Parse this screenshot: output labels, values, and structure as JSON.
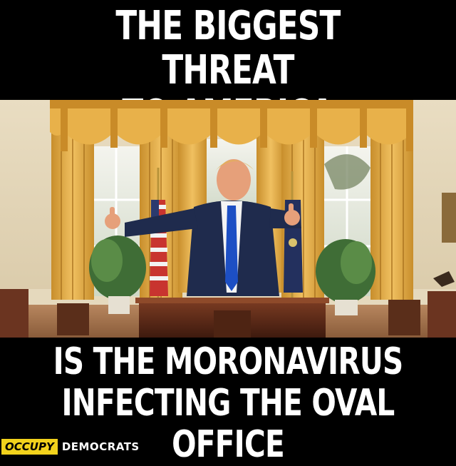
{
  "top_caption": {
    "line1": "THE BIGGEST THREAT",
    "line2": "TO AMERICA"
  },
  "bottom_caption": {
    "line1": "IS THE MORONAVIRUS",
    "line2": "INFECTING THE OVAL OFFICE"
  },
  "brand": {
    "occupy": "OCCUPY",
    "democrats": "DEMOCRATS",
    "accent_color": "#f2d21c"
  },
  "photo": {
    "icon": "oval-office-photo"
  }
}
